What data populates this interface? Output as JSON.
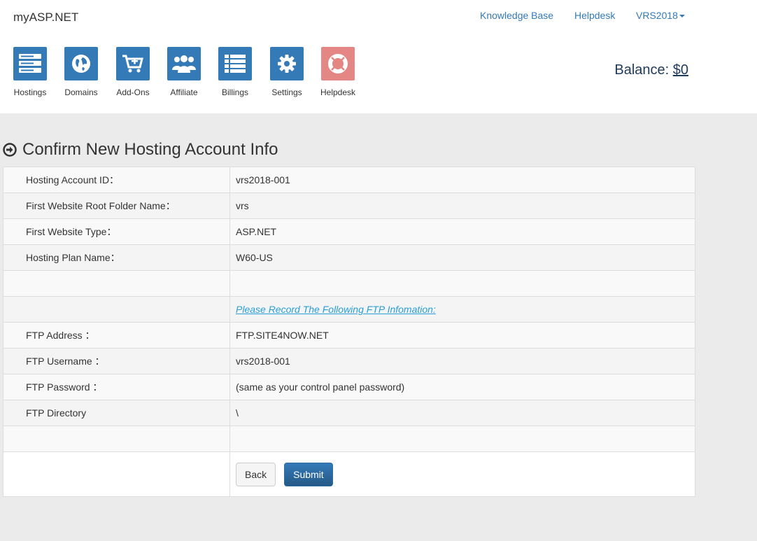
{
  "brand": "myASP.NET",
  "topnav": {
    "knowledge_base": "Knowledge Base",
    "helpdesk": "Helpdesk",
    "account": "VRS2018"
  },
  "icons": [
    {
      "label": "Hostings",
      "icon": "server-icon",
      "color": "#337ab7"
    },
    {
      "label": "Domains",
      "icon": "globe-icon",
      "color": "#337ab7"
    },
    {
      "label": "Add-Ons",
      "icon": "cart-plus-icon",
      "color": "#337ab7"
    },
    {
      "label": "Affiliate",
      "icon": "users-icon",
      "color": "#337ab7"
    },
    {
      "label": "Billings",
      "icon": "list-icon",
      "color": "#337ab7"
    },
    {
      "label": "Settings",
      "icon": "gear-icon",
      "color": "#337ab7"
    },
    {
      "label": "Helpdesk",
      "icon": "lifebuoy-icon",
      "color": "#d9534f"
    }
  ],
  "balance": {
    "label": "Balance: ",
    "amount": "$0"
  },
  "page_title": "Confirm New Hosting Account Info",
  "rows": [
    {
      "label": "Hosting Account ID：",
      "value": "vrs2018-001"
    },
    {
      "label": "First Website Root Folder Name：",
      "value": "vrs"
    },
    {
      "label": "First Website Type：",
      "value": "ASP.NET"
    },
    {
      "label": "Hosting Plan Name：",
      "value": "W60-US"
    },
    {
      "label": "",
      "value": ""
    },
    {
      "label": "",
      "value": "Please Record The Following FTP Infomation:"
    },
    {
      "label": "FTP Address ：",
      "value": "FTP.SITE4NOW.NET"
    },
    {
      "label": "FTP Username ：",
      "value": "vrs2018-001"
    },
    {
      "label": "FTP Password ：",
      "value": "(same as your control panel password)"
    },
    {
      "label": "FTP Directory",
      "value": "\\"
    },
    {
      "label": "",
      "value": ""
    }
  ],
  "buttons": {
    "back": "Back",
    "submit": "Submit"
  }
}
